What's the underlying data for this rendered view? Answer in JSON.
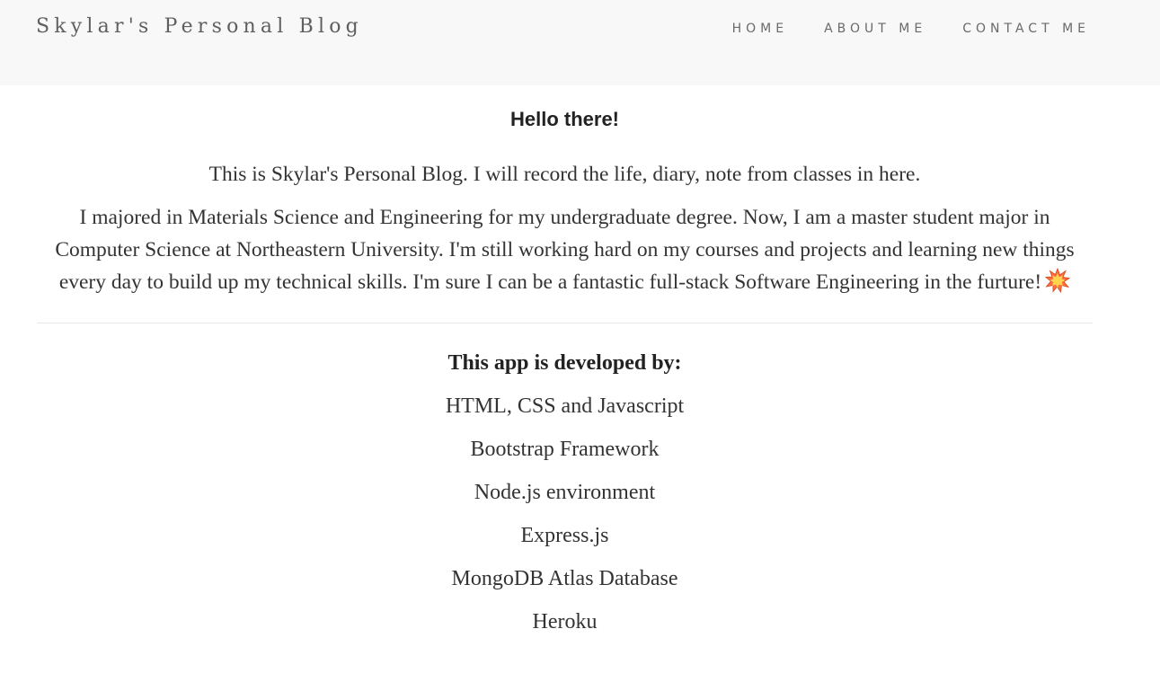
{
  "navbar": {
    "brand": "Skylar's Personal Blog",
    "links": [
      {
        "label": "HOME"
      },
      {
        "label": "ABOUT ME"
      },
      {
        "label": "CONTACT ME"
      }
    ]
  },
  "main": {
    "greeting": "Hello there!",
    "intro": "This is Skylar's Personal Blog. I will record the life, diary, note from classes in here.",
    "bio": "I majored in Materials Science and Engineering for my undergraduate degree. Now, I am a master student major in Computer Science at Northeastern University. I'm still working hard on my courses and projects and learning new things every day to build up my technical skills. I'm sure I can be a fantastic full-stack Software Engineering in the furture!",
    "bio_emoji": "collision-icon",
    "developed_by_title": "This app is developed by:",
    "tech": [
      "HTML, CSS and Javascript",
      "Bootstrap Framework",
      "Node.js environment",
      "Express.js",
      "MongoDB Atlas Database",
      "Heroku"
    ]
  },
  "colors": {
    "navbar_bg": "#f8f8f8",
    "brand_text": "#5f5f5f",
    "body_text": "#333333"
  }
}
